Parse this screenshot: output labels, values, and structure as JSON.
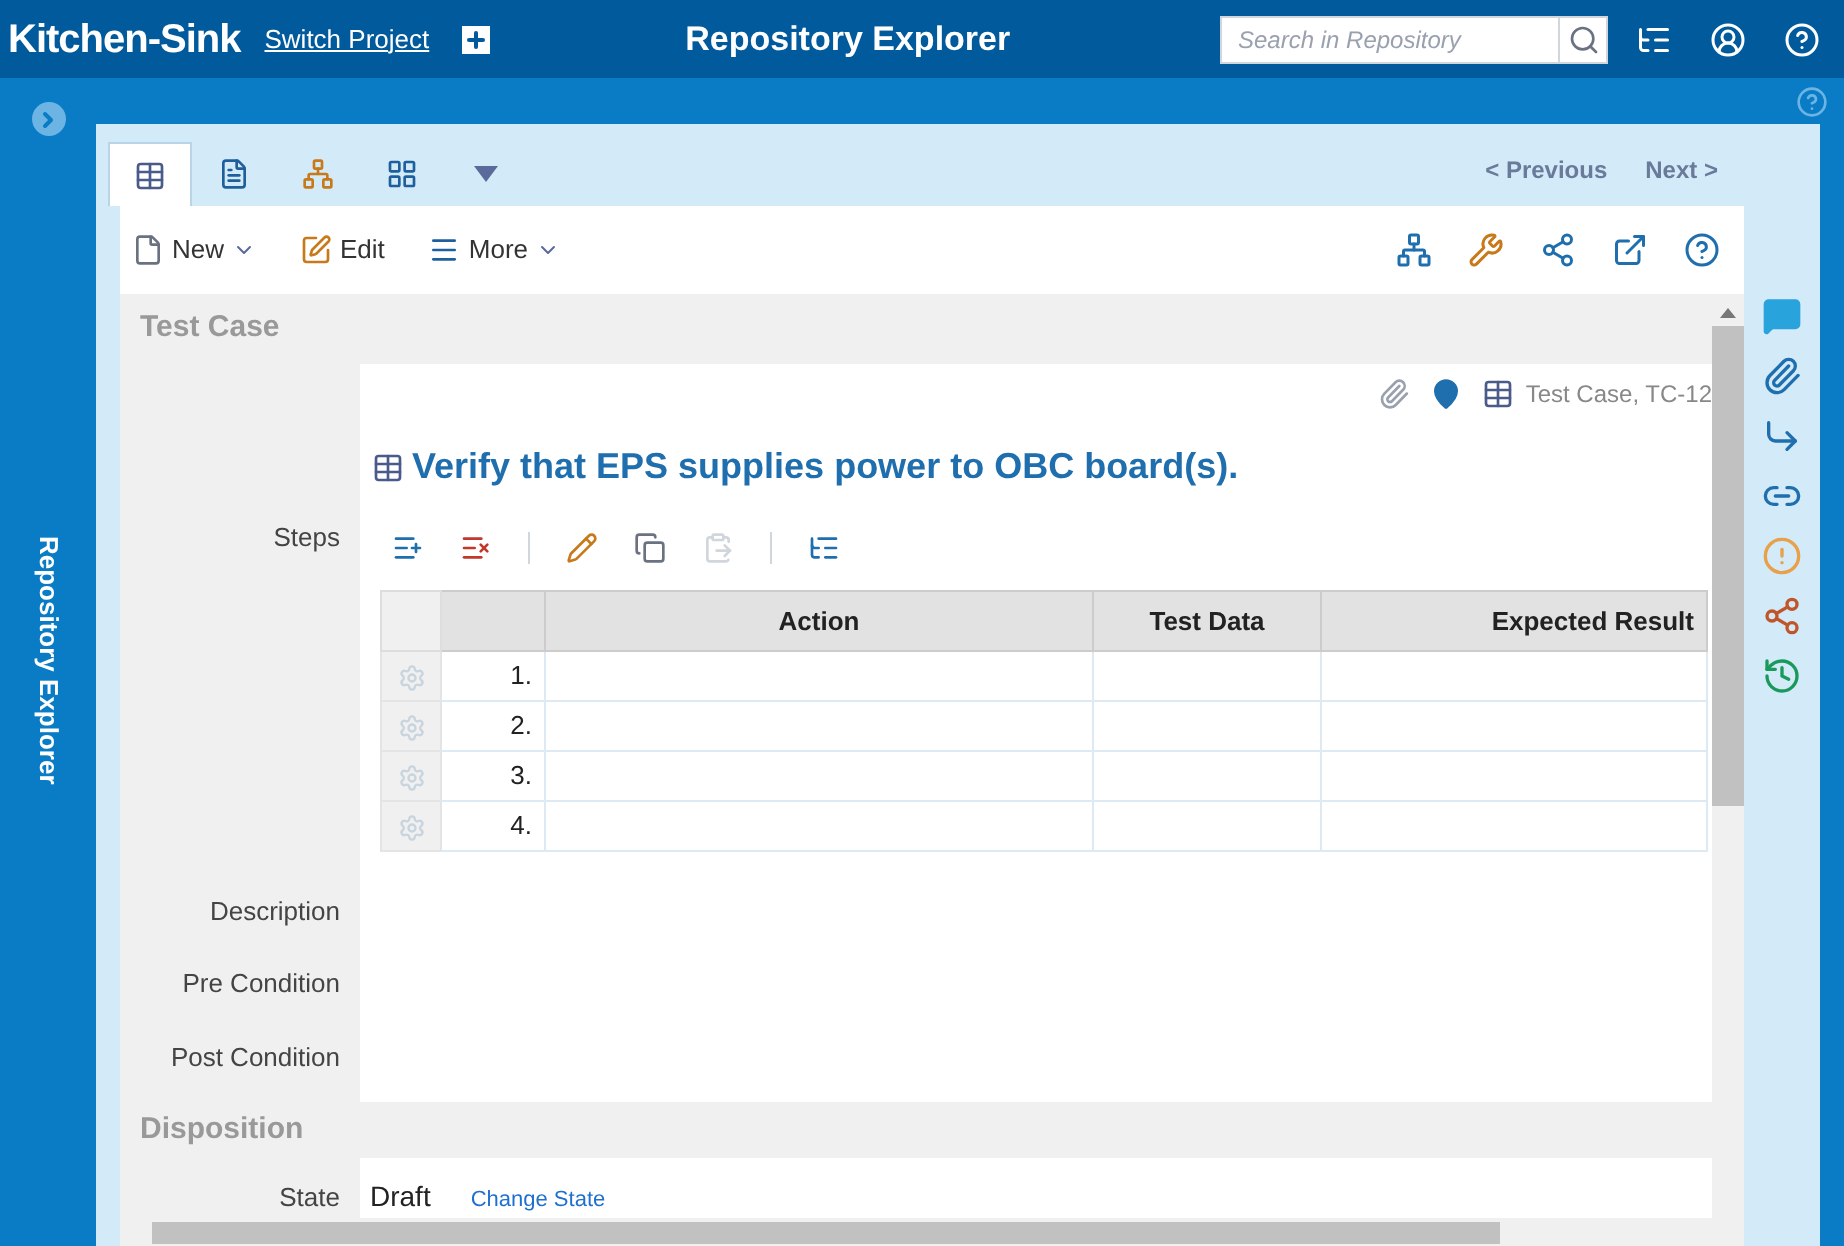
{
  "header": {
    "project": "Kitchen-Sink",
    "switch_link": "Switch Project",
    "title": "Repository Explorer",
    "search": {
      "placeholder": "Search in Repository"
    }
  },
  "side_rail": {
    "label": "Repository Explorer"
  },
  "tabs": [
    {
      "kind": "form",
      "selected": true
    },
    {
      "kind": "document",
      "selected": false
    },
    {
      "kind": "tree",
      "selected": false
    },
    {
      "kind": "grid",
      "selected": false
    },
    {
      "kind": "dropdown",
      "selected": false
    }
  ],
  "pager": {
    "previous": "< Previous",
    "next": "Next >"
  },
  "toolbar": {
    "new": "New",
    "edit": "Edit",
    "more": "More"
  },
  "sections": [
    {
      "title": "Test Case"
    },
    {
      "title": "Disposition"
    }
  ],
  "item": {
    "meta": "Test Case, TC-12",
    "title": "Verify that EPS supplies power to OBC board(s)."
  },
  "steps": {
    "label": "Steps",
    "columns": [
      "Action",
      "Test Data",
      "Expected Result"
    ],
    "rows": [
      {
        "number": "1."
      },
      {
        "number": "2."
      },
      {
        "number": "3."
      },
      {
        "number": "4."
      }
    ]
  },
  "fields": [
    {
      "label": "Description"
    },
    {
      "label": "Pre Condition"
    },
    {
      "label": "Post Condition"
    }
  ],
  "state": {
    "label": "State",
    "value": "Draft",
    "link": "Change State"
  }
}
